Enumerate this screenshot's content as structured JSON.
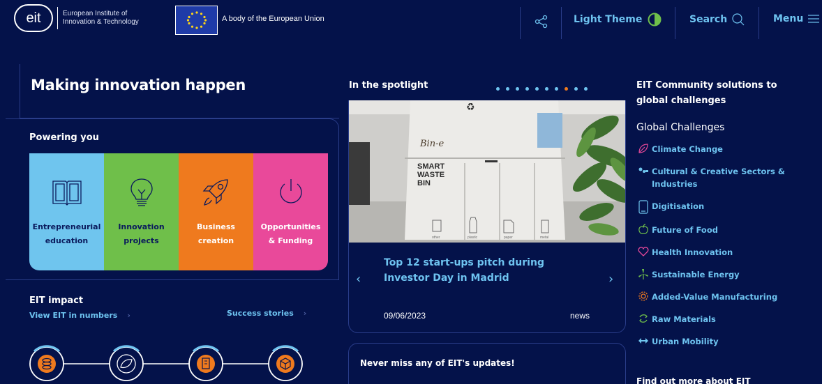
{
  "header": {
    "logo_text": "eit",
    "org_line1": "European Institute of",
    "org_line2": "Innovation & Technology",
    "eu_text": "A body of the European Union",
    "theme_label": "Light Theme",
    "search_label": "Search",
    "menu_label": "Menu"
  },
  "hero": {
    "title": "Making innovation happen"
  },
  "powering": {
    "title": "Powering you",
    "tiles": [
      {
        "line1": "Entrepreneurial",
        "line2": "education",
        "icon": "book-icon"
      },
      {
        "line1": "Innovation",
        "line2": "projects",
        "icon": "lightbulb-icon"
      },
      {
        "line1": "Business",
        "line2": "creation",
        "icon": "rocket-icon"
      },
      {
        "line1": "Opportunities",
        "line2": "& Funding",
        "icon": "power-icon"
      }
    ]
  },
  "impact": {
    "title": "EIT impact",
    "numbers_link": "View EIT in numbers",
    "stories_link": "Success stories",
    "icons": [
      "coins-icon",
      "leaf-icon",
      "building-icon",
      "box-icon"
    ]
  },
  "spotlight": {
    "title": "In the spotlight",
    "dot_count": 10,
    "active_dot": 7,
    "headline": "Top 12 start-ups pitch during Investor Day in Madrid",
    "date": "09/06/2023",
    "tag": "news",
    "image": {
      "brand": "Bin-e",
      "label_line1": "SMART",
      "label_line2": "WASTE",
      "label_line3": "BIN",
      "compartments": [
        "other",
        "plastic",
        "paper",
        "metal"
      ]
    }
  },
  "updates": {
    "title": "Never miss any of EIT's updates!"
  },
  "community": {
    "title": "EIT Community solutions to global challenges",
    "global_title": "Global Challenges",
    "items": [
      {
        "label": "Climate Change",
        "icon": "leaf-icon",
        "color": "#e9499a"
      },
      {
        "label": "Cultural & Creative Sectors & Industries",
        "icon": "creative-icon",
        "color": "#6fc5ee"
      },
      {
        "label": "Digitisation",
        "icon": "tablet-icon",
        "color": "#6fc5ee"
      },
      {
        "label": "Future of Food",
        "icon": "apple-icon",
        "color": "#6fbf4a"
      },
      {
        "label": "Health Innovation",
        "icon": "heart-icon",
        "color": "#e9499a"
      },
      {
        "label": "Sustainable Energy",
        "icon": "wind-turbine-icon",
        "color": "#6fbf4a"
      },
      {
        "label": "Added-Value Manufacturing",
        "icon": "gear-icon",
        "color": "#ef7a1e"
      },
      {
        "label": "Raw Materials",
        "icon": "recycle-icon",
        "color": "#6fbf4a"
      },
      {
        "label": "Urban Mobility",
        "icon": "arrows-icon",
        "color": "#6fc5ee"
      }
    ],
    "find_out": "Find out more about EIT"
  },
  "colors": {
    "background": "#04124a",
    "accent_link": "#6ec3f0",
    "border": "#2a3d8a",
    "tile_blue": "#6fc5ee",
    "tile_green": "#6fbf4a",
    "tile_orange": "#ef7a1e",
    "tile_pink": "#e9499a"
  }
}
